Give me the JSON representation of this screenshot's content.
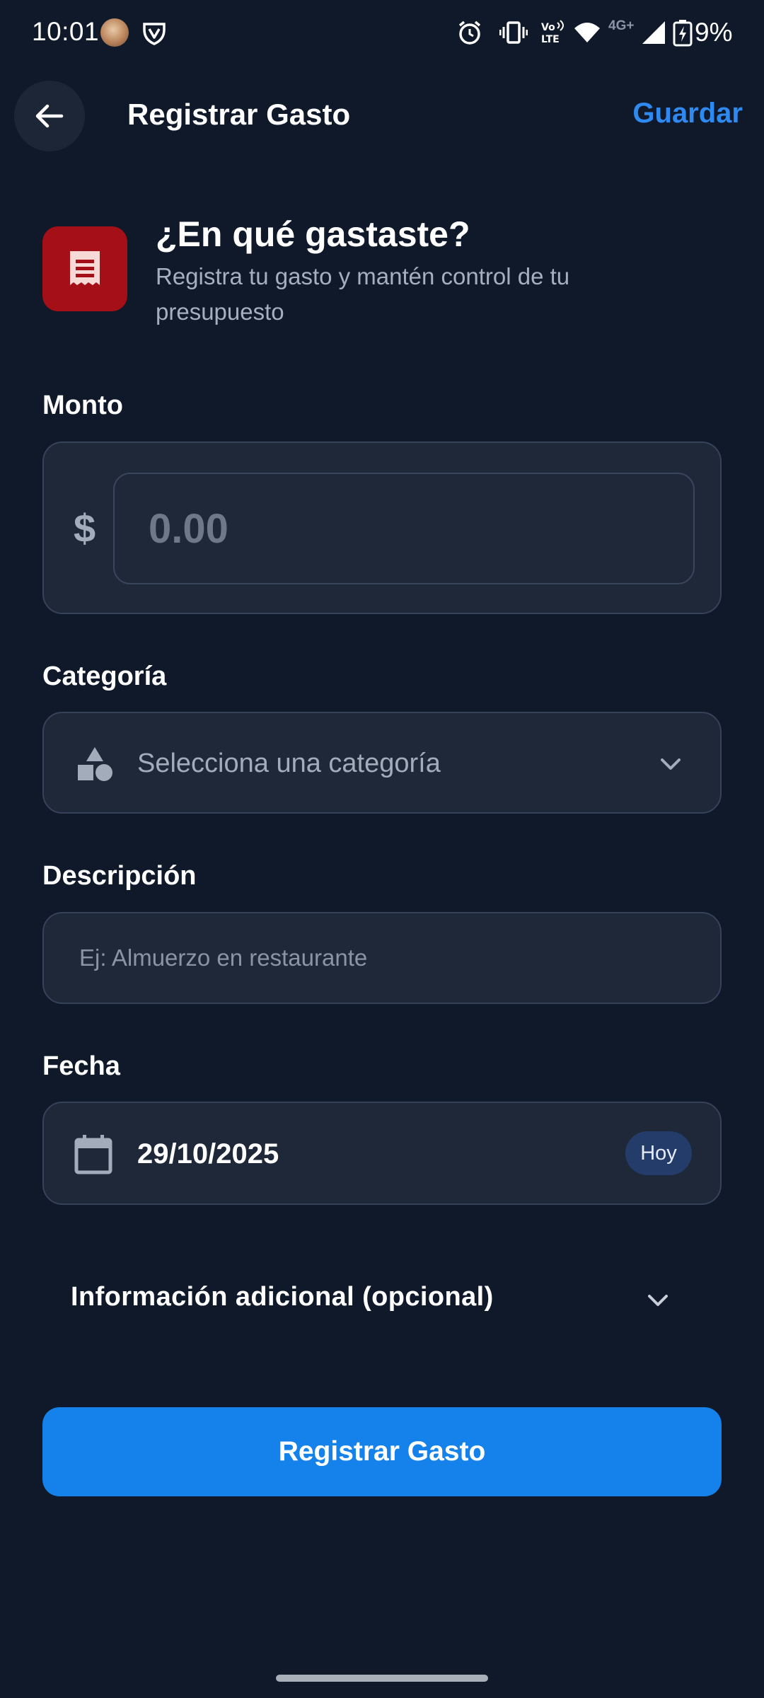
{
  "status_bar": {
    "time": "10:01",
    "network": "4G+",
    "battery": "9%",
    "icons": [
      "avatar",
      "vpn-shield-icon",
      "alarm-icon",
      "vibrate-icon",
      "volte-icon",
      "wifi-icon",
      "signal-icon",
      "battery-charging-icon"
    ]
  },
  "app_bar": {
    "back_icon": "arrow-left-icon",
    "title": "Registrar Gasto",
    "save_label": "Guardar"
  },
  "header": {
    "icon": "receipt-icon",
    "title": "¿En qué gastaste?",
    "subtitle": "Registra tu gasto y mantén control de tu presupuesto"
  },
  "amount": {
    "label": "Monto",
    "currency": "$",
    "placeholder": "0.00"
  },
  "category": {
    "label": "Categoría",
    "icon": "category-shapes-icon",
    "placeholder": "Selecciona una categoría"
  },
  "description": {
    "label": "Descripción",
    "placeholder": "Ej: Almuerzo en restaurante"
  },
  "date": {
    "label": "Fecha",
    "icon": "calendar-icon",
    "value": "29/10/2025",
    "badge": "Hoy"
  },
  "additional": {
    "label": "Información adicional (opcional)"
  },
  "submit": {
    "label": "Registrar Gasto"
  },
  "colors": {
    "background": "#0F1929",
    "surface": "#1E2838",
    "border": "#36425A",
    "accent": "#1581EA",
    "link": "#2E8AF0",
    "header_icon_bg": "#A50F17",
    "badge_bg": "#233C69"
  }
}
